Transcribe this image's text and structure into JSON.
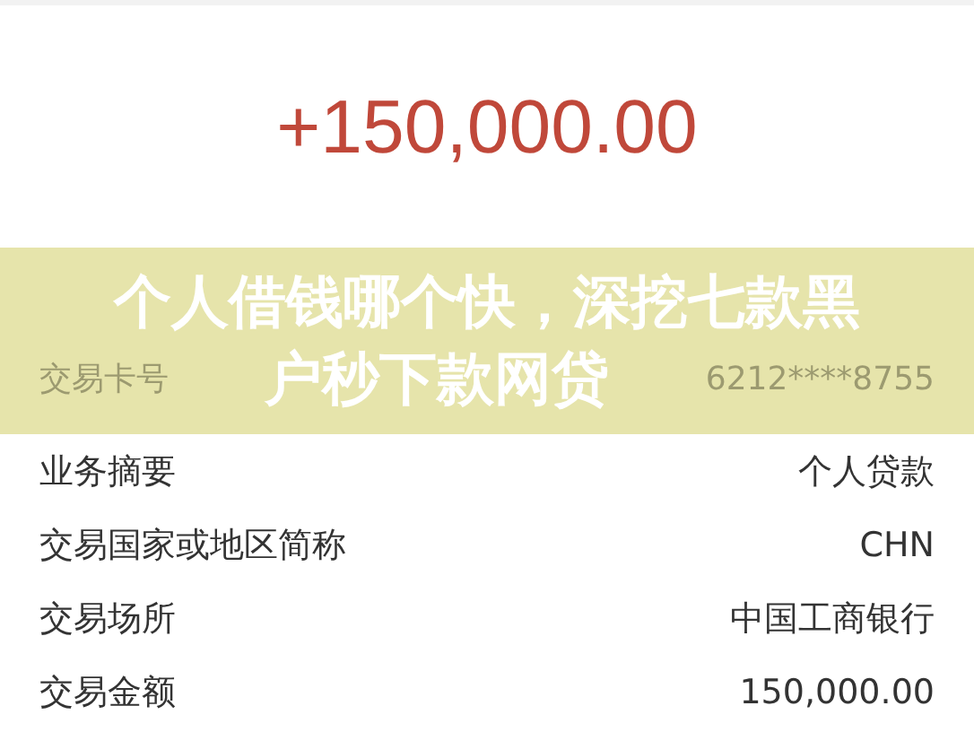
{
  "amount": "+150,000.00",
  "banner": {
    "title_lines": [
      "个人借钱哪个快，深挖七款黑",
      "户秒下款网贷"
    ],
    "row": {
      "label": "交易卡号",
      "value": "6212****8755"
    }
  },
  "details": [
    {
      "label": "业务摘要",
      "value": "个人贷款"
    },
    {
      "label": "交易国家或地区简称",
      "value": "CHN"
    },
    {
      "label": "交易场所",
      "value": "中国工商银行"
    },
    {
      "label": "交易金额",
      "value": "150,000.00"
    }
  ]
}
